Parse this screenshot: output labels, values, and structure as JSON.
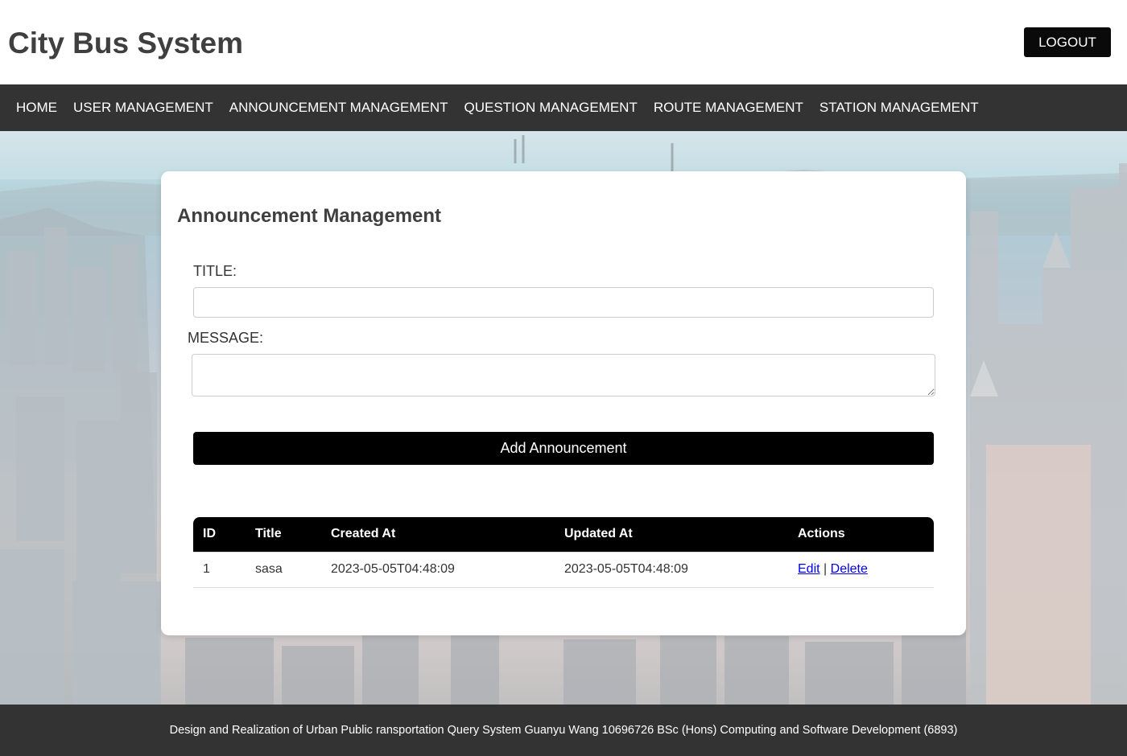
{
  "header": {
    "title": "City Bus System",
    "logout_label": "LOGOUT"
  },
  "nav": {
    "items": [
      {
        "label": "HOME"
      },
      {
        "label": "USER MANAGEMENT"
      },
      {
        "label": "ANNOUNCEMENT MANAGEMENT"
      },
      {
        "label": "QUESTION MANAGEMENT"
      },
      {
        "label": "ROUTE MANAGEMENT"
      },
      {
        "label": "STATION MANAGEMENT"
      }
    ]
  },
  "form": {
    "heading": "Announcement Management",
    "title_label": "TITLE:",
    "title_value": "",
    "message_label": "MESSAGE:",
    "message_value": "",
    "submit_label": "Add Announcement"
  },
  "table": {
    "headers": [
      "ID",
      "Title",
      "Created At",
      "Updated At",
      "Actions"
    ],
    "rows": [
      {
        "id": "1",
        "title": "sasa",
        "created_at": "2023-05-05T04:48:09",
        "updated_at": "2023-05-05T04:48:09",
        "edit_label": "Edit",
        "separator": "|",
        "delete_label": "Delete"
      }
    ]
  },
  "footer": {
    "text": "Design and Realization of Urban Public ransportation Query System Guanyu Wang 10696726 BSc (Hons) Computing and Software Development (6893)"
  }
}
